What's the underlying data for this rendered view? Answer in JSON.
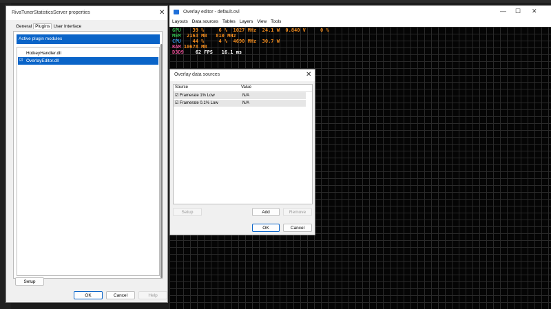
{
  "rtss": {
    "title": "RivaTunerStatisticsServer properties",
    "tabs": [
      "General",
      "Plugins",
      "User Interface"
    ],
    "section_header": "Active plugin modules",
    "plugins": [
      {
        "name": "HotkeyHandler.dll",
        "checked": false
      },
      {
        "name": "OverlayEditor.dll",
        "checked": true
      }
    ],
    "buttons": {
      "setup": "Setup",
      "ok": "OK",
      "cancel": "Cancel",
      "help": "Help"
    }
  },
  "overlay_editor": {
    "title": "Overlay editor - default.ovl",
    "menu": [
      "Layouts",
      "Data sources",
      "Tables",
      "Layers",
      "View",
      "Tools"
    ],
    "overlay_lines": [
      {
        "label": "GPU",
        "text": "    39 %     6 %  1027 MHz  24.1 W  0.840 V     0 %",
        "label_color": "#2fb34a"
      },
      {
        "label": "MEM",
        "text": "  2163 MB   810 MHz",
        "label_color": "#2fb34a"
      },
      {
        "label": "CPU",
        "text": "    44 %     4 %  4690 MHz  30.7 W",
        "label_color": "#2f8fd9"
      },
      {
        "label": "RAM",
        "text": " 10678 MB",
        "label_color": "#e04a90"
      },
      {
        "label": "D3D9",
        "text": "    62 FPS   16.1 ms",
        "label_color": "#e04a90"
      }
    ],
    "value_color": "#f08a1c"
  },
  "data_sources": {
    "title": "Overlay data sources",
    "columns": [
      "Source",
      "Value"
    ],
    "rows": [
      {
        "source": "Framerate 1% Low",
        "value": "N/A"
      },
      {
        "source": "Framerate 0.1% Low",
        "value": "N/A"
      }
    ],
    "buttons": {
      "setup": "Setup",
      "add": "Add",
      "remove": "Remove",
      "ok": "OK",
      "cancel": "Cancel"
    }
  }
}
